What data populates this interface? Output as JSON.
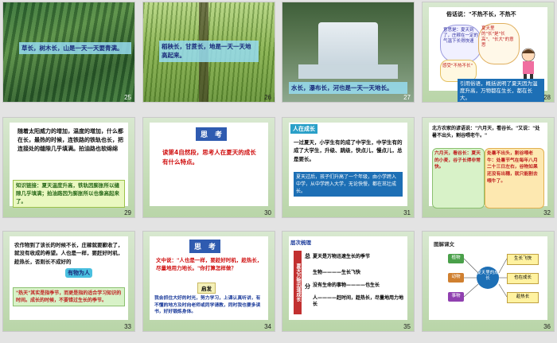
{
  "slides": [
    {
      "num": "25",
      "caption": "草长，树木长，山是一天一天要青满。"
    },
    {
      "num": "26",
      "caption": "稻秧长，甘蔗长，地是一天一天地高起来。"
    },
    {
      "num": "27",
      "caption": "水长，瀑布长，河也是一天一天地长。"
    },
    {
      "num": "28",
      "proverb": "俗话说：\"不热不长，不热不",
      "bubble1": "意思是：夏天到了，庄稼在一定的气温下长得快速",
      "bubble2": "夏天里的\"长\"是\"长高\"、\"长大\"的意思",
      "bubble3": "感受\"不热不长\"",
      "note": "引用俗语，概括说明了夏天因为温度升高，万物都在生长，都在长大。"
    },
    {
      "num": "29",
      "body": "随着太阳威力的增加，温度的增加，什么都在长，最热的时候，连铁路的铁轨也长，把连接处的缝隙几乎填满。拍油路也软绵绵",
      "hint": "知识链接：夏天温度升高，铁轨因膨胀所以缝隙几乎填满；拍油路因为膨胀所以也像高起来了。"
    },
    {
      "num": "30",
      "title": "思　考",
      "question": "读第4自然段，思考人在夏天的成长有什么特点。"
    },
    {
      "num": "31",
      "title": "人在成长",
      "body": "一过夏天，小学生有的成了中学生，中学生有的成了大学生，升级、跳级，快点儿，慢点儿，总是要长。",
      "summary": "夏天过后，孩子们升高了一个年级，由小学跨入中学，从中学跨入大学，无论快慢，都在茁壮成长。"
    },
    {
      "num": "32",
      "proverb": "北方农家的谚语说：\"六月天，看谷长。\"又说：\"处暑不出头，割谷喂老牛。\"",
      "box1": "六月天，看谷长：夏天的小麦，谷子长得非常快。",
      "box2": "处暑不出头，割谷喂老牛：处暑节气在每年八月二十三日左右，谷物如果还没有出穗，就只能割去喂牛了。"
    },
    {
      "num": "33",
      "body": "农作物到了该长的时候不长，庄稼就要歉收了，就没有收成的希望。人也是一样，要赶好时机，趁热长，否则长不成好的",
      "highlight": "有物为人",
      "note": "\"热天\"其实是指季节，而更是指的适合学习知识的时间。成长的时候，不要错过生长的季节。"
    },
    {
      "num": "34",
      "title": "思　考",
      "quote": "文中说：\"人也是一样，要趁好时机，趁热长，尽量地用力地长。\"你打算怎样做？",
      "subtitle": "启发",
      "answer": "我会抓住大好的时光，努力学习，上课认真听讲，有不懂的地方及时向老师或同学请教，同时我也要多读书，好好锻炼身体。"
    },
    {
      "num": "35",
      "title": "层次梳理",
      "vlabel": "夏天万物迅速成长",
      "h1": "总",
      "h2": "分",
      "h2b": "总",
      "line1": "夏天是万物迅速生长的季节",
      "line2": "生物————生长飞快",
      "line3": "没有生命的事物————也生长",
      "line4": "人————赶时间，趁热长，尽量地用力地长"
    },
    {
      "num": "36",
      "title": "图解课文",
      "center": "夏天里的成长",
      "left": [
        "植物",
        "动物",
        "事物"
      ],
      "right": [
        "生长飞快",
        "也在成长",
        "趁热长"
      ]
    }
  ]
}
